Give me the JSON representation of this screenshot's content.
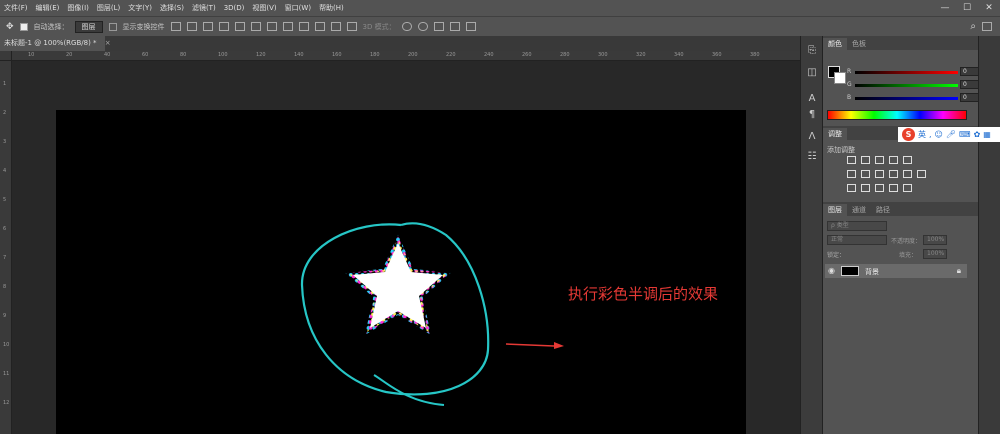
{
  "menubar": {
    "items": [
      "文件(F)",
      "编辑(E)",
      "图像(I)",
      "图层(L)",
      "文字(Y)",
      "选择(S)",
      "滤镜(T)",
      "3D(D)",
      "视图(V)",
      "窗口(W)",
      "帮助(H)"
    ],
    "minimize": "—",
    "maximize": "☐",
    "close": "✕"
  },
  "options": {
    "auto_select_label": "自动选择：",
    "auto_select_value": "图层",
    "show_transform_label": "显示变换控件",
    "mode_3d_label": "3D 模式："
  },
  "document": {
    "tab_title": "未标题-1 @ 100%(RGB/8) *",
    "close_icon": "×"
  },
  "rulers": {
    "h_ticks": [
      "10",
      "20",
      "40",
      "60",
      "80",
      "100",
      "120",
      "140",
      "160",
      "180",
      "200",
      "220",
      "240",
      "260",
      "280",
      "300",
      "320",
      "340",
      "360",
      "380"
    ],
    "v_ticks": [
      "1",
      "2",
      "3",
      "4",
      "5",
      "6",
      "7",
      "8",
      "9",
      "10",
      "11",
      "12"
    ]
  },
  "annotation": {
    "text": "执行彩色半调后的效果",
    "color": "#e53935",
    "circle_color": "#26c6c6"
  },
  "color_panel": {
    "tabs": [
      "颜色",
      "色板"
    ],
    "channels": [
      {
        "label": "R",
        "value": "0"
      },
      {
        "label": "G",
        "value": "0"
      },
      {
        "label": "B",
        "value": "0"
      }
    ]
  },
  "ime_bar": {
    "logo": "S",
    "mode": "英"
  },
  "adjust_panel": {
    "tabs": [
      "调整"
    ],
    "subtitle": "添加调整"
  },
  "layers_panel": {
    "tabs": [
      "图层",
      "通道",
      "路径"
    ],
    "filter_placeholder": "ρ 类型",
    "blend_mode": "正常",
    "opacity_label": "不透明度：",
    "opacity_value": "100%",
    "lock_label": "锁定：",
    "fill_label": "填充：",
    "fill_value": "100%",
    "layer_name": "背景"
  },
  "icons": [
    "move-tool-icon",
    "eye-icon",
    "lock-icon",
    "search-icon",
    "workspace-icon"
  ]
}
